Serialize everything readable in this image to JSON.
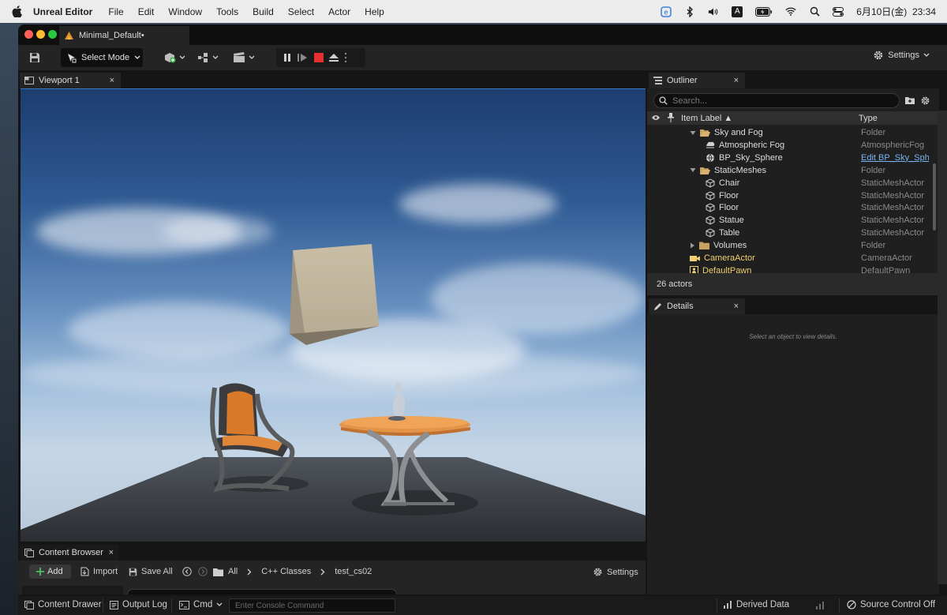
{
  "menubar": {
    "app_name": "Unreal Editor",
    "items": [
      "File",
      "Edit",
      "Window",
      "Tools",
      "Build",
      "Select",
      "Actor",
      "Help"
    ],
    "status_icons": [
      "e-icon",
      "bluetooth-icon",
      "volume-icon",
      "input-source-icon",
      "battery-icon",
      "wifi-icon",
      "spotlight-icon",
      "control-center-icon"
    ],
    "input_source": "A",
    "datetime": "6月10日(金)  23:34"
  },
  "window": {
    "doc_tab": "Minimal_Default•",
    "toolbar": {
      "select_mode": "Select Mode",
      "settings": "Settings"
    }
  },
  "viewport": {
    "tab_label": "Viewport 1",
    "close": "×"
  },
  "outliner": {
    "tab_label": "Outliner",
    "close": "×",
    "search_placeholder": "Search...",
    "columns": {
      "label": "Item Label ▲",
      "type": "Type"
    },
    "rows": [
      {
        "label": "Sky and Fog",
        "type": "Folder",
        "kind": "folder-open",
        "indent": 1
      },
      {
        "label": "Atmospheric Fog",
        "type": "AtmosphericFog",
        "kind": "fog",
        "indent": 2
      },
      {
        "label": "BP_Sky_Sphere",
        "type": "Edit BP_Sky_Sphe",
        "kind": "sphere",
        "indent": 2,
        "type_link": true
      },
      {
        "label": "StaticMeshes",
        "type": "Folder",
        "kind": "folder-open",
        "indent": 1
      },
      {
        "label": "Chair",
        "type": "StaticMeshActor",
        "kind": "mesh",
        "indent": 2
      },
      {
        "label": "Floor",
        "type": "StaticMeshActor",
        "kind": "mesh",
        "indent": 2
      },
      {
        "label": "Floor",
        "type": "StaticMeshActor",
        "kind": "mesh",
        "indent": 2
      },
      {
        "label": "Statue",
        "type": "StaticMeshActor",
        "kind": "mesh",
        "indent": 2
      },
      {
        "label": "Table",
        "type": "StaticMeshActor",
        "kind": "mesh",
        "indent": 2
      },
      {
        "label": "Volumes",
        "type": "Folder",
        "kind": "folder-closed",
        "indent": 1
      },
      {
        "label": "CameraActor",
        "type": "CameraActor",
        "kind": "camera",
        "indent": 1,
        "highlight": true
      },
      {
        "label": "DefaultPawn",
        "type": "DefaultPawn",
        "kind": "pawn",
        "indent": 1,
        "highlight": true
      }
    ],
    "actor_count": "26 actors"
  },
  "details": {
    "tab_label": "Details",
    "close": "×",
    "hint": "Select an object to view details."
  },
  "content_browser": {
    "tab_label": "Content Browser",
    "close": "×",
    "add": "Add",
    "import": "Import",
    "save_all": "Save All",
    "path": [
      "All",
      "C++ Classes",
      "test_cs02"
    ],
    "settings": "Settings"
  },
  "statusbar": {
    "content_drawer": "Content Drawer",
    "output_log": "Output Log",
    "cmd": "Cmd",
    "console_placeholder": "Enter Console Command",
    "derived_data": "Derived Data",
    "source_control": "Source Control Off"
  },
  "colors": {
    "accent_blue": "#3a78c8",
    "highlight_yellow": "#f0d070",
    "link_blue": "#7ab4f0",
    "folder": "#c8a060",
    "stop_red": "#e53030"
  }
}
